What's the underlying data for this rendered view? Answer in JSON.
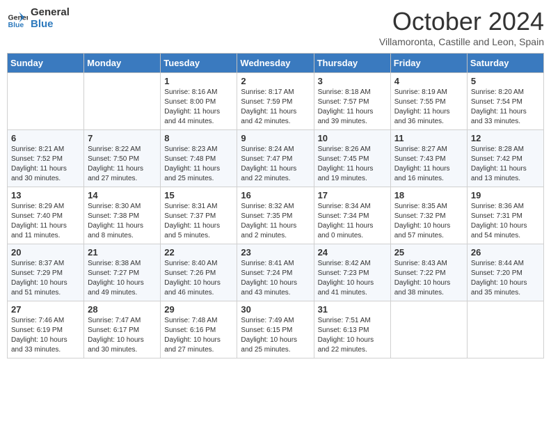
{
  "header": {
    "logo_line1": "General",
    "logo_line2": "Blue",
    "month": "October 2024",
    "location": "Villamoronta, Castille and Leon, Spain"
  },
  "days_of_week": [
    "Sunday",
    "Monday",
    "Tuesday",
    "Wednesday",
    "Thursday",
    "Friday",
    "Saturday"
  ],
  "weeks": [
    [
      {
        "num": "",
        "info": ""
      },
      {
        "num": "",
        "info": ""
      },
      {
        "num": "1",
        "info": "Sunrise: 8:16 AM\nSunset: 8:00 PM\nDaylight: 11 hours and 44 minutes."
      },
      {
        "num": "2",
        "info": "Sunrise: 8:17 AM\nSunset: 7:59 PM\nDaylight: 11 hours and 42 minutes."
      },
      {
        "num": "3",
        "info": "Sunrise: 8:18 AM\nSunset: 7:57 PM\nDaylight: 11 hours and 39 minutes."
      },
      {
        "num": "4",
        "info": "Sunrise: 8:19 AM\nSunset: 7:55 PM\nDaylight: 11 hours and 36 minutes."
      },
      {
        "num": "5",
        "info": "Sunrise: 8:20 AM\nSunset: 7:54 PM\nDaylight: 11 hours and 33 minutes."
      }
    ],
    [
      {
        "num": "6",
        "info": "Sunrise: 8:21 AM\nSunset: 7:52 PM\nDaylight: 11 hours and 30 minutes."
      },
      {
        "num": "7",
        "info": "Sunrise: 8:22 AM\nSunset: 7:50 PM\nDaylight: 11 hours and 27 minutes."
      },
      {
        "num": "8",
        "info": "Sunrise: 8:23 AM\nSunset: 7:48 PM\nDaylight: 11 hours and 25 minutes."
      },
      {
        "num": "9",
        "info": "Sunrise: 8:24 AM\nSunset: 7:47 PM\nDaylight: 11 hours and 22 minutes."
      },
      {
        "num": "10",
        "info": "Sunrise: 8:26 AM\nSunset: 7:45 PM\nDaylight: 11 hours and 19 minutes."
      },
      {
        "num": "11",
        "info": "Sunrise: 8:27 AM\nSunset: 7:43 PM\nDaylight: 11 hours and 16 minutes."
      },
      {
        "num": "12",
        "info": "Sunrise: 8:28 AM\nSunset: 7:42 PM\nDaylight: 11 hours and 13 minutes."
      }
    ],
    [
      {
        "num": "13",
        "info": "Sunrise: 8:29 AM\nSunset: 7:40 PM\nDaylight: 11 hours and 11 minutes."
      },
      {
        "num": "14",
        "info": "Sunrise: 8:30 AM\nSunset: 7:38 PM\nDaylight: 11 hours and 8 minutes."
      },
      {
        "num": "15",
        "info": "Sunrise: 8:31 AM\nSunset: 7:37 PM\nDaylight: 11 hours and 5 minutes."
      },
      {
        "num": "16",
        "info": "Sunrise: 8:32 AM\nSunset: 7:35 PM\nDaylight: 11 hours and 2 minutes."
      },
      {
        "num": "17",
        "info": "Sunrise: 8:34 AM\nSunset: 7:34 PM\nDaylight: 11 hours and 0 minutes."
      },
      {
        "num": "18",
        "info": "Sunrise: 8:35 AM\nSunset: 7:32 PM\nDaylight: 10 hours and 57 minutes."
      },
      {
        "num": "19",
        "info": "Sunrise: 8:36 AM\nSunset: 7:31 PM\nDaylight: 10 hours and 54 minutes."
      }
    ],
    [
      {
        "num": "20",
        "info": "Sunrise: 8:37 AM\nSunset: 7:29 PM\nDaylight: 10 hours and 51 minutes."
      },
      {
        "num": "21",
        "info": "Sunrise: 8:38 AM\nSunset: 7:27 PM\nDaylight: 10 hours and 49 minutes."
      },
      {
        "num": "22",
        "info": "Sunrise: 8:40 AM\nSunset: 7:26 PM\nDaylight: 10 hours and 46 minutes."
      },
      {
        "num": "23",
        "info": "Sunrise: 8:41 AM\nSunset: 7:24 PM\nDaylight: 10 hours and 43 minutes."
      },
      {
        "num": "24",
        "info": "Sunrise: 8:42 AM\nSunset: 7:23 PM\nDaylight: 10 hours and 41 minutes."
      },
      {
        "num": "25",
        "info": "Sunrise: 8:43 AM\nSunset: 7:22 PM\nDaylight: 10 hours and 38 minutes."
      },
      {
        "num": "26",
        "info": "Sunrise: 8:44 AM\nSunset: 7:20 PM\nDaylight: 10 hours and 35 minutes."
      }
    ],
    [
      {
        "num": "27",
        "info": "Sunrise: 7:46 AM\nSunset: 6:19 PM\nDaylight: 10 hours and 33 minutes."
      },
      {
        "num": "28",
        "info": "Sunrise: 7:47 AM\nSunset: 6:17 PM\nDaylight: 10 hours and 30 minutes."
      },
      {
        "num": "29",
        "info": "Sunrise: 7:48 AM\nSunset: 6:16 PM\nDaylight: 10 hours and 27 minutes."
      },
      {
        "num": "30",
        "info": "Sunrise: 7:49 AM\nSunset: 6:15 PM\nDaylight: 10 hours and 25 minutes."
      },
      {
        "num": "31",
        "info": "Sunrise: 7:51 AM\nSunset: 6:13 PM\nDaylight: 10 hours and 22 minutes."
      },
      {
        "num": "",
        "info": ""
      },
      {
        "num": "",
        "info": ""
      }
    ]
  ]
}
